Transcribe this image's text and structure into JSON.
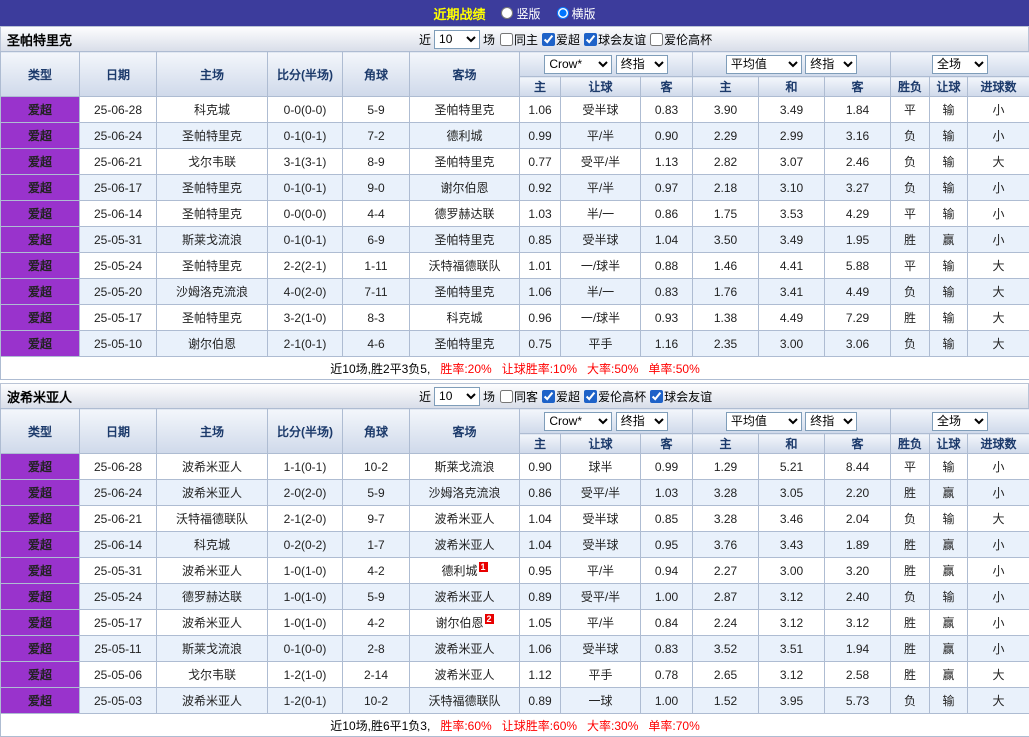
{
  "top_bar": {
    "title": "近期战绩",
    "view_options": [
      {
        "label": "竖版",
        "selected": false
      },
      {
        "label": "横版",
        "selected": true
      }
    ]
  },
  "filter_labels": {
    "near": "近",
    "games": "场"
  },
  "table_header": {
    "type": "类型",
    "date": "日期",
    "home": "主场",
    "score": "比分(半场)",
    "corners": "角球",
    "away": "客场",
    "odds_company": "Crow*",
    "odds_final": "终指",
    "avg_label": "平均值",
    "avg_final": "终指",
    "full_label": "全场",
    "odds_home": "主",
    "odds_handicap": "让球",
    "odds_away": "客",
    "avg_home": "主",
    "avg_draw": "和",
    "avg_away": "客",
    "result": "胜负",
    "handicap_result": "让球",
    "goals": "进球数"
  },
  "colors": {
    "topbar": "#3c3c9c",
    "title": "#ffff00",
    "league_badge": "#9933cc",
    "focal_team": "#009900",
    "win": "#ff0000",
    "loss": "#0000ff"
  },
  "sections": [
    {
      "team": "圣帕特里克",
      "count": "10",
      "checkboxes": [
        {
          "label": "同主",
          "checked": false
        },
        {
          "label": "爱超",
          "checked": true
        },
        {
          "label": "球会友谊",
          "checked": true
        },
        {
          "label": "爱伦高杯",
          "checked": false
        }
      ],
      "rows": [
        {
          "league": "爱超",
          "date": "25-06-28",
          "home": "科克城",
          "home_focal": false,
          "score": "0-0(0-0)",
          "corners": "5-9",
          "away": "圣帕特里克",
          "away_focal": true,
          "odds": [
            "1.06",
            "受半球",
            "0.83"
          ],
          "avg": [
            "3.90",
            "3.49",
            "1.84"
          ],
          "result": "平",
          "handicap": "输",
          "goals": "小"
        },
        {
          "league": "爱超",
          "date": "25-06-24",
          "home": "圣帕特里克",
          "home_focal": true,
          "score": "0-1(0-1)",
          "corners": "7-2",
          "away": "德利城",
          "away_focal": false,
          "odds": [
            "0.99",
            "平/半",
            "0.90"
          ],
          "avg": [
            "2.29",
            "2.99",
            "3.16"
          ],
          "result": "负",
          "handicap": "输",
          "goals": "小"
        },
        {
          "league": "爱超",
          "date": "25-06-21",
          "home": "戈尔韦联",
          "home_focal": false,
          "score": "3-1(3-1)",
          "corners": "8-9",
          "away": "圣帕特里克",
          "away_focal": true,
          "odds": [
            "0.77",
            "受平/半",
            "1.13"
          ],
          "avg": [
            "2.82",
            "3.07",
            "2.46"
          ],
          "result": "负",
          "handicap": "输",
          "goals": "大"
        },
        {
          "league": "爱超",
          "date": "25-06-17",
          "home": "圣帕特里克",
          "home_focal": true,
          "score": "0-1(0-1)",
          "corners": "9-0",
          "away": "谢尔伯恩",
          "away_focal": false,
          "odds": [
            "0.92",
            "平/半",
            "0.97"
          ],
          "avg": [
            "2.18",
            "3.10",
            "3.27"
          ],
          "result": "负",
          "handicap": "输",
          "goals": "小"
        },
        {
          "league": "爱超",
          "date": "25-06-14",
          "home": "圣帕特里克",
          "home_focal": true,
          "score": "0-0(0-0)",
          "corners": "4-4",
          "away": "德罗赫达联",
          "away_focal": false,
          "odds": [
            "1.03",
            "半/一",
            "0.86"
          ],
          "avg": [
            "1.75",
            "3.53",
            "4.29"
          ],
          "result": "平",
          "handicap": "输",
          "goals": "小"
        },
        {
          "league": "爱超",
          "date": "25-05-31",
          "home": "斯莱戈流浪",
          "home_focal": false,
          "score": "0-1(0-1)",
          "corners": "6-9",
          "away": "圣帕特里克",
          "away_focal": true,
          "odds": [
            "0.85",
            "受半球",
            "1.04"
          ],
          "avg": [
            "3.50",
            "3.49",
            "1.95"
          ],
          "result": "胜",
          "handicap": "赢",
          "goals": "小"
        },
        {
          "league": "爱超",
          "date": "25-05-24",
          "home": "圣帕特里克",
          "home_focal": true,
          "score": "2-2(2-1)",
          "corners": "1-11",
          "away": "沃特福德联队",
          "away_focal": false,
          "odds": [
            "1.01",
            "一/球半",
            "0.88"
          ],
          "avg": [
            "1.46",
            "4.41",
            "5.88"
          ],
          "result": "平",
          "handicap": "输",
          "goals": "大"
        },
        {
          "league": "爱超",
          "date": "25-05-20",
          "home": "沙姆洛克流浪",
          "home_focal": false,
          "score": "4-0(2-0)",
          "corners": "7-11",
          "away": "圣帕特里克",
          "away_focal": true,
          "odds": [
            "1.06",
            "半/一",
            "0.83"
          ],
          "avg": [
            "1.76",
            "3.41",
            "4.49"
          ],
          "result": "负",
          "handicap": "输",
          "goals": "大"
        },
        {
          "league": "爱超",
          "date": "25-05-17",
          "home": "圣帕特里克",
          "home_focal": true,
          "score": "3-2(1-0)",
          "corners": "8-3",
          "away": "科克城",
          "away_focal": false,
          "odds": [
            "0.96",
            "一/球半",
            "0.93"
          ],
          "avg": [
            "1.38",
            "4.49",
            "7.29"
          ],
          "result": "胜",
          "handicap": "输",
          "goals": "大"
        },
        {
          "league": "爱超",
          "date": "25-05-10",
          "home": "谢尔伯恩",
          "home_focal": false,
          "score": "2-1(0-1)",
          "corners": "4-6",
          "away": "圣帕特里克",
          "away_focal": true,
          "odds": [
            "0.75",
            "平手",
            "1.16"
          ],
          "avg": [
            "2.35",
            "3.00",
            "3.06"
          ],
          "result": "负",
          "handicap": "输",
          "goals": "大"
        }
      ],
      "summary": {
        "prefix": "近10场,胜2平3负5,",
        "stats": [
          "胜率:20%",
          "让球胜率:10%",
          "大率:50%",
          "单率:50%"
        ]
      }
    },
    {
      "team": "波希米亚人",
      "count": "10",
      "checkboxes": [
        {
          "label": "同客",
          "checked": false
        },
        {
          "label": "爱超",
          "checked": true
        },
        {
          "label": "爱伦高杯",
          "checked": true
        },
        {
          "label": "球会友谊",
          "checked": true
        }
      ],
      "rows": [
        {
          "league": "爱超",
          "date": "25-06-28",
          "home": "波希米亚人",
          "home_focal": true,
          "score": "1-1(0-1)",
          "corners": "10-2",
          "away": "斯莱戈流浪",
          "away_focal": false,
          "odds": [
            "0.90",
            "球半",
            "0.99"
          ],
          "avg": [
            "1.29",
            "5.21",
            "8.44"
          ],
          "result": "平",
          "handicap": "输",
          "goals": "小"
        },
        {
          "league": "爱超",
          "date": "25-06-24",
          "home": "波希米亚人",
          "home_focal": true,
          "score": "2-0(2-0)",
          "corners": "5-9",
          "away": "沙姆洛克流浪",
          "away_focal": false,
          "odds": [
            "0.86",
            "受平/半",
            "1.03"
          ],
          "avg": [
            "3.28",
            "3.05",
            "2.20"
          ],
          "result": "胜",
          "handicap": "赢",
          "goals": "小"
        },
        {
          "league": "爱超",
          "date": "25-06-21",
          "home": "沃特福德联队",
          "home_focal": false,
          "score": "2-1(2-0)",
          "corners": "9-7",
          "away": "波希米亚人",
          "away_focal": true,
          "odds": [
            "1.04",
            "受半球",
            "0.85"
          ],
          "avg": [
            "3.28",
            "3.46",
            "2.04"
          ],
          "result": "负",
          "handicap": "输",
          "goals": "大"
        },
        {
          "league": "爱超",
          "date": "25-06-14",
          "home": "科克城",
          "home_focal": false,
          "score": "0-2(0-2)",
          "corners": "1-7",
          "away": "波希米亚人",
          "away_focal": true,
          "odds": [
            "1.04",
            "受半球",
            "0.95"
          ],
          "avg": [
            "3.76",
            "3.43",
            "1.89"
          ],
          "result": "胜",
          "handicap": "赢",
          "goals": "小"
        },
        {
          "league": "爱超",
          "date": "25-05-31",
          "home": "波希米亚人",
          "home_focal": true,
          "score": "1-0(1-0)",
          "corners": "4-2",
          "away": "德利城",
          "away_focal": false,
          "away_badge": "1",
          "odds": [
            "0.95",
            "平/半",
            "0.94"
          ],
          "avg": [
            "2.27",
            "3.00",
            "3.20"
          ],
          "result": "胜",
          "handicap": "赢",
          "goals": "小"
        },
        {
          "league": "爱超",
          "date": "25-05-24",
          "home": "德罗赫达联",
          "home_focal": false,
          "score": "1-0(1-0)",
          "corners": "5-9",
          "away": "波希米亚人",
          "away_focal": true,
          "odds": [
            "0.89",
            "受平/半",
            "1.00"
          ],
          "avg": [
            "2.87",
            "3.12",
            "2.40"
          ],
          "result": "负",
          "handicap": "输",
          "goals": "小"
        },
        {
          "league": "爱超",
          "date": "25-05-17",
          "home": "波希米亚人",
          "home_focal": true,
          "score": "1-0(1-0)",
          "corners": "4-2",
          "away": "谢尔伯恩",
          "away_focal": false,
          "away_badge": "2",
          "odds": [
            "1.05",
            "平/半",
            "0.84"
          ],
          "avg": [
            "2.24",
            "3.12",
            "3.12"
          ],
          "result": "胜",
          "handicap": "赢",
          "goals": "小"
        },
        {
          "league": "爱超",
          "date": "25-05-11",
          "home": "斯莱戈流浪",
          "home_focal": false,
          "score": "0-1(0-0)",
          "corners": "2-8",
          "away": "波希米亚人",
          "away_focal": true,
          "odds": [
            "1.06",
            "受半球",
            "0.83"
          ],
          "avg": [
            "3.52",
            "3.51",
            "1.94"
          ],
          "result": "胜",
          "handicap": "赢",
          "goals": "小"
        },
        {
          "league": "爱超",
          "date": "25-05-06",
          "home": "戈尔韦联",
          "home_focal": false,
          "score": "1-2(1-0)",
          "corners": "2-14",
          "away": "波希米亚人",
          "away_focal": true,
          "odds": [
            "1.12",
            "平手",
            "0.78"
          ],
          "avg": [
            "2.65",
            "3.12",
            "2.58"
          ],
          "result": "胜",
          "handicap": "赢",
          "goals": "大"
        },
        {
          "league": "爱超",
          "date": "25-05-03",
          "home": "波希米亚人",
          "home_focal": true,
          "score": "1-2(0-1)",
          "corners": "10-2",
          "away": "沃特福德联队",
          "away_focal": false,
          "odds": [
            "0.89",
            "一球",
            "1.00"
          ],
          "avg": [
            "1.52",
            "3.95",
            "5.73"
          ],
          "result": "负",
          "handicap": "输",
          "goals": "大"
        }
      ],
      "summary": {
        "prefix": "近10场,胜6平1负3,",
        "stats": [
          "胜率:60%",
          "让球胜率:60%",
          "大率:30%",
          "单率:70%"
        ]
      }
    }
  ]
}
